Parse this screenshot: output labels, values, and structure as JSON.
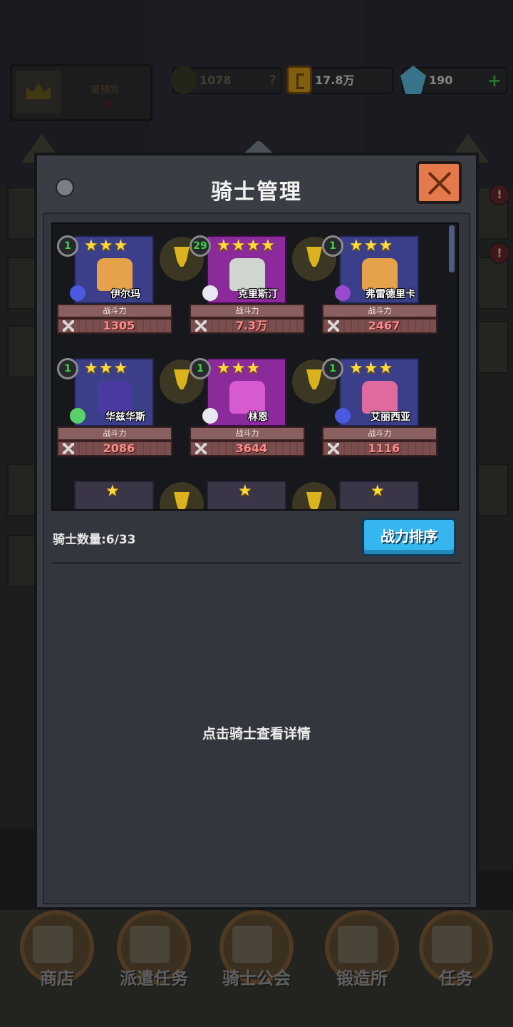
{
  "hud": {
    "player_name": "星预同",
    "player_sub": "三世",
    "medal_value": "1078",
    "medal_help": "?",
    "gold": "17.8万",
    "gems": "190",
    "gems_plus": "+"
  },
  "panel": {
    "title": "骑士管理",
    "knight_count": "骑士数量:6/33",
    "sort_button": "战力排序",
    "hint": "点击骑士查看详情",
    "power_label": "战斗力"
  },
  "knights": [
    {
      "level": "1",
      "stars": "★★★",
      "name": "伊尔玛",
      "power": "1305"
    },
    {
      "level": "29",
      "stars": "★★★★",
      "name": "克里斯汀",
      "power": "7.3万"
    },
    {
      "level": "1",
      "stars": "★★★",
      "name": "弗雷德里卡",
      "power": "2467"
    },
    {
      "level": "1",
      "stars": "★★★",
      "name": "华兹华斯",
      "power": "2086"
    },
    {
      "level": "1",
      "stars": "★★★",
      "name": "林恩",
      "power": "3644"
    },
    {
      "level": "1",
      "stars": "★★★",
      "name": "艾丽西亚",
      "power": "1116"
    },
    {
      "stars": "★"
    },
    {
      "stars": "★"
    },
    {
      "stars": "★"
    }
  ],
  "side": {
    "alert_1": "!",
    "alert_2": "!"
  },
  "nav": [
    {
      "label": "商店"
    },
    {
      "label": "派遣任务"
    },
    {
      "label": "骑士公会"
    },
    {
      "label": "锻造所"
    },
    {
      "label": "任务"
    }
  ],
  "colors": {
    "panel": "#3a3d44",
    "accent_blue": "#35b6ee",
    "close_orange": "#e4794b",
    "star_yellow": "#ffd93a",
    "power_red": "#ff8a8a",
    "level_green": "#3ed43e"
  }
}
